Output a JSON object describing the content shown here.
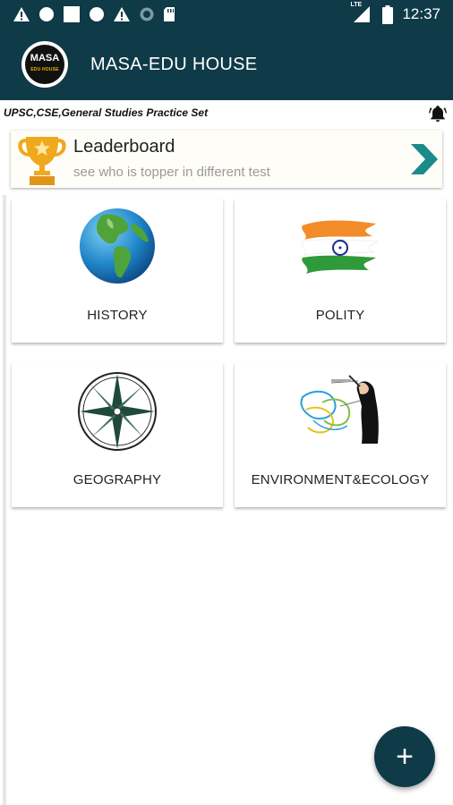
{
  "status_bar": {
    "time": "12:37",
    "network_label": "LTE",
    "icons": [
      "warning-icon",
      "circle-icon",
      "square-icon",
      "circle-icon",
      "warning-icon",
      "sync-icon",
      "sd-card-icon",
      "signal-icon",
      "battery-icon"
    ]
  },
  "app_bar": {
    "logo_text": "MASA",
    "logo_subtext": "EDU HOUSE",
    "title": "MASA-EDU HOUSE"
  },
  "subheader": {
    "text": "UPSC,CSE,General Studies Practice Set",
    "icon": "bell-icon"
  },
  "leaderboard": {
    "title": "Leaderboard",
    "subtitle": "see who is topper in different test",
    "icon": "trophy-icon",
    "arrow_icon": "chevron-right-icon",
    "accent": "#1a8a8a"
  },
  "categories": [
    {
      "label": "HISTORY",
      "icon": "globe-icon"
    },
    {
      "label": "POLITY",
      "icon": "india-flag-icon"
    },
    {
      "label": "GEOGRAPHY",
      "icon": "compass-rose-icon"
    },
    {
      "label": "ENVIRONMENT&ECOLOGY",
      "icon": "diagram-drawing-icon"
    }
  ],
  "fab": {
    "label": "+",
    "icon": "plus-icon"
  },
  "colors": {
    "primary": "#0f3a47",
    "background": "#ffffff"
  }
}
